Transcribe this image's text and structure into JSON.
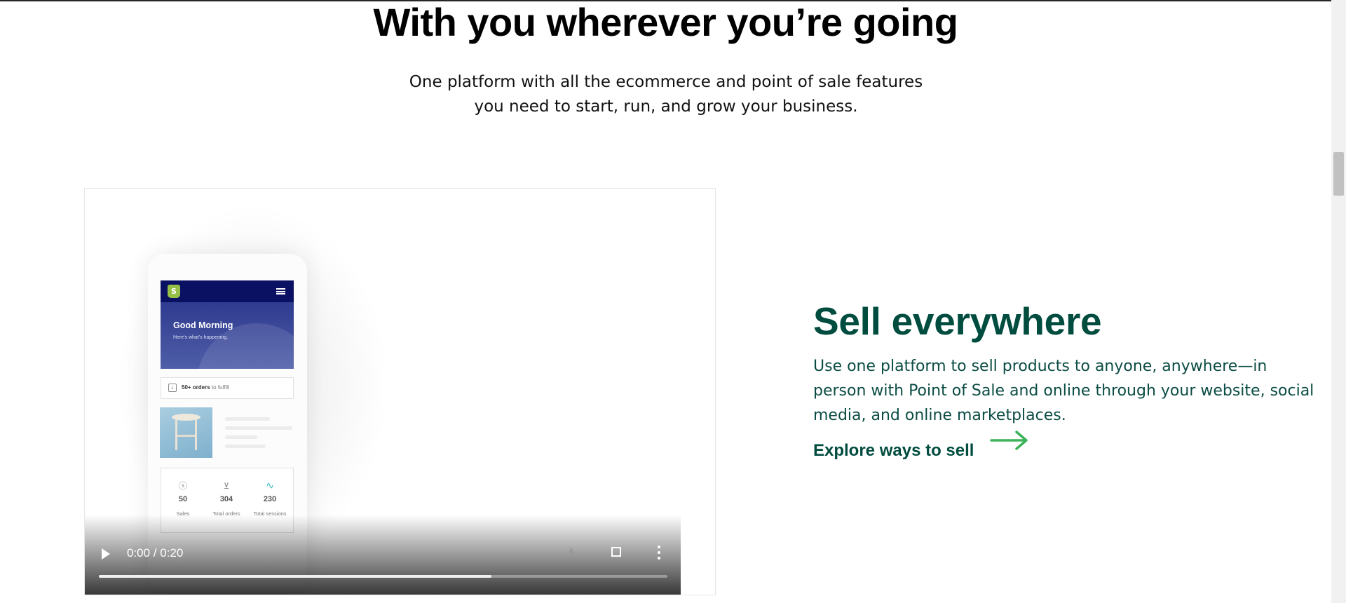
{
  "hero": {
    "title": "With you wherever you’re going",
    "subtitle_line1": "One platform with all the ecommerce and point of sale features",
    "subtitle_line2": "you need to start, run, and grow your business."
  },
  "app_mock": {
    "logo": "S",
    "greeting_title": "Good Morning",
    "greeting_sub": "Here's what's happening.",
    "orders_bold": "50+ orders",
    "orders_rest": " to fulfill",
    "stats": [
      {
        "icon": "dollar-icon",
        "value": "50",
        "label": "Sales"
      },
      {
        "icon": "inbox-icon",
        "value": "304",
        "label": "Total orders"
      },
      {
        "icon": "sessions-graph-icon",
        "value": "230",
        "label": "Total sessions"
      }
    ]
  },
  "video": {
    "time": "0:00 / 0:20",
    "progress": 0.69
  },
  "feature": {
    "title": "Sell everywhere",
    "description": "Use one platform to sell products to anyone, anywhere—in person with Point of Sale and online through your website, social media, and online marketplaces.",
    "link_label": "Explore ways to sell",
    "brand_color": "#004c3f",
    "arrow_color": "#3db35b"
  }
}
